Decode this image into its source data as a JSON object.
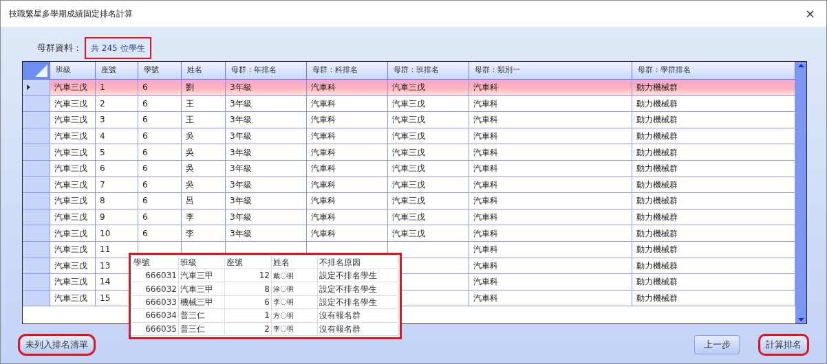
{
  "window": {
    "title": "技職繁星多學期成績固定排名計算",
    "close": "×"
  },
  "population": {
    "label": "母群資料：",
    "count": "共 245 位學生"
  },
  "table": {
    "columns": [
      "班級",
      "座號",
      "學號",
      "姓名",
      "母群：年排名",
      "母群：科排名",
      "母群：班排名",
      "母群：類別一",
      "母群：學群排名"
    ],
    "rows": [
      {
        "selected": true,
        "cells": [
          "汽車三戊",
          "1",
          "6",
          "劉",
          "3年級",
          "汽車科",
          "汽車三戊",
          "汽車科",
          "動力機械群"
        ]
      },
      {
        "selected": false,
        "cells": [
          "汽車三戊",
          "2",
          "6",
          "王",
          "3年級",
          "汽車科",
          "汽車三戊",
          "汽車科",
          "動力機械群"
        ]
      },
      {
        "selected": false,
        "cells": [
          "汽車三戊",
          "3",
          "6",
          "王",
          "3年級",
          "汽車科",
          "汽車三戊",
          "汽車科",
          "動力機械群"
        ]
      },
      {
        "selected": false,
        "cells": [
          "汽車三戊",
          "4",
          "6",
          "吳",
          "3年級",
          "汽車科",
          "汽車三戊",
          "汽車科",
          "動力機械群"
        ]
      },
      {
        "selected": false,
        "cells": [
          "汽車三戊",
          "5",
          "6",
          "吳",
          "3年級",
          "汽車科",
          "汽車三戊",
          "汽車科",
          "動力機械群"
        ]
      },
      {
        "selected": false,
        "cells": [
          "汽車三戊",
          "6",
          "6",
          "吳",
          "3年級",
          "汽車科",
          "汽車三戊",
          "汽車科",
          "動力機械群"
        ]
      },
      {
        "selected": false,
        "cells": [
          "汽車三戊",
          "7",
          "6",
          "吳",
          "3年級",
          "汽車科",
          "汽車三戊",
          "汽車科",
          "動力機械群"
        ]
      },
      {
        "selected": false,
        "cells": [
          "汽車三戊",
          "8",
          "6",
          "呂",
          "3年級",
          "汽車科",
          "汽車三戊",
          "汽車科",
          "動力機械群"
        ]
      },
      {
        "selected": false,
        "cells": [
          "汽車三戊",
          "9",
          "6",
          "李",
          "3年級",
          "汽車科",
          "汽車三戊",
          "汽車科",
          "動力機械群"
        ]
      },
      {
        "selected": false,
        "cells": [
          "汽車三戊",
          "10",
          "6",
          "李",
          "3年級",
          "汽車科",
          "汽車三戊",
          "汽車科",
          "動力機械群"
        ]
      },
      {
        "selected": false,
        "cells": [
          "汽車三戊",
          "11",
          null,
          null,
          null,
          null,
          null,
          "汽車科",
          "動力機械群"
        ]
      },
      {
        "selected": false,
        "cells": [
          "汽車三戊",
          "13",
          null,
          null,
          null,
          null,
          null,
          "汽車科",
          "動力機械群"
        ]
      },
      {
        "selected": false,
        "cells": [
          "汽車三戊",
          "14",
          null,
          null,
          null,
          null,
          null,
          "汽車科",
          "動力機械群"
        ]
      },
      {
        "selected": false,
        "cells": [
          "汽車三戊",
          "15",
          null,
          null,
          null,
          null,
          null,
          "汽車科",
          "動力機械群"
        ]
      }
    ]
  },
  "unranked_popup": {
    "columns": [
      "學號",
      "班級",
      "座號",
      "姓名",
      "不排名原因"
    ],
    "rows": [
      [
        "666031",
        "汽車三甲",
        "12",
        "戴〇明",
        "設定不排名學生"
      ],
      [
        "666032",
        "汽車三甲",
        "8",
        "涂〇明",
        "設定不排名學生"
      ],
      [
        "666033",
        "機械三甲",
        "6",
        "李〇明",
        "設定不排名學生"
      ],
      [
        "666034",
        "普三仁",
        "1",
        "方〇明",
        "沒有報名群"
      ],
      [
        "666035",
        "普三仁",
        "2",
        "李〇明",
        "沒有報名群"
      ]
    ]
  },
  "buttons": {
    "unranked_list": "未列入排名清單",
    "back": "上一步",
    "calculate": "計算排名"
  }
}
